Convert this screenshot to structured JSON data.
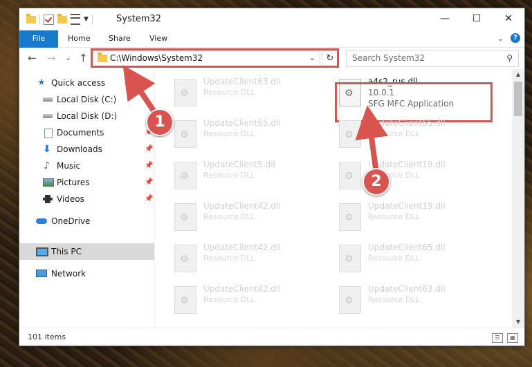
{
  "window": {
    "title": "System32",
    "controls": {
      "minimize": "—",
      "maximize": "☐",
      "close": "✕"
    }
  },
  "ribbon": {
    "tabs": [
      "File",
      "Home",
      "Share",
      "View"
    ],
    "expand_icon": "chevron-down-icon",
    "help_label": "?"
  },
  "navigation": {
    "back": "←",
    "forward": "→",
    "recent": "⌄",
    "up": "↑",
    "address": "C:\\Windows\\System32",
    "refresh": "↻",
    "search_placeholder": "Search System32"
  },
  "sidebar": {
    "items": [
      {
        "label": "Quick access",
        "icon": "star-icon"
      },
      {
        "label": "Local Disk (C:)",
        "icon": "disk-icon"
      },
      {
        "label": "Local Disk (D:)",
        "icon": "disk-icon"
      },
      {
        "label": "Documents",
        "icon": "documents-icon",
        "pinned": true
      },
      {
        "label": "Downloads",
        "icon": "downloads-icon",
        "pinned": true
      },
      {
        "label": "Music",
        "icon": "music-icon",
        "pinned": true
      },
      {
        "label": "Pictures",
        "icon": "pictures-icon",
        "pinned": true
      },
      {
        "label": "Videos",
        "icon": "videos-icon",
        "pinned": true
      },
      {
        "label": "OneDrive",
        "icon": "onedrive-icon"
      },
      {
        "label": "This PC",
        "icon": "this-pc-icon",
        "selected": true
      },
      {
        "label": "Network",
        "icon": "network-icon"
      }
    ],
    "pin_glyph": "📌"
  },
  "files": {
    "main": {
      "name": "a4s2_rus.dll",
      "version": "10.0.1",
      "description": "SFG MFC Application"
    },
    "left_column": [
      {
        "name": "UpdateClient63.dll",
        "description": "Resource DLL"
      },
      {
        "name": "UpdateClient65.dll",
        "description": "Resource DLL"
      },
      {
        "name": "UpdateClient5.dll",
        "description": "Resource DLL"
      },
      {
        "name": "UpdateClient42.dll",
        "description": "Resource DLL"
      },
      {
        "name": "UpdateClient42.dll",
        "description": "Resource DLL"
      },
      {
        "name": "UpdateClient42.dll",
        "description": "Resource DLL"
      }
    ],
    "right_column": [
      {
        "name": "UpdateClient65.dll",
        "description": "Resource DLL"
      },
      {
        "name": "UpdateClient19.dll",
        "description": "Resource DLL"
      },
      {
        "name": "UpdateClient19.dll",
        "description": "Resource DLL"
      },
      {
        "name": "UpdateClient65.dll",
        "description": "Resource DLL"
      },
      {
        "name": "UpdateClient63.dll",
        "description": "Resource DLL"
      }
    ]
  },
  "status": {
    "item_count": "101 items"
  },
  "annotations": {
    "step1": "1",
    "step2": "2",
    "highlight_color": "#d9534f"
  },
  "colors": {
    "accent": "#1979ca",
    "selection": "#d9d9d9"
  }
}
